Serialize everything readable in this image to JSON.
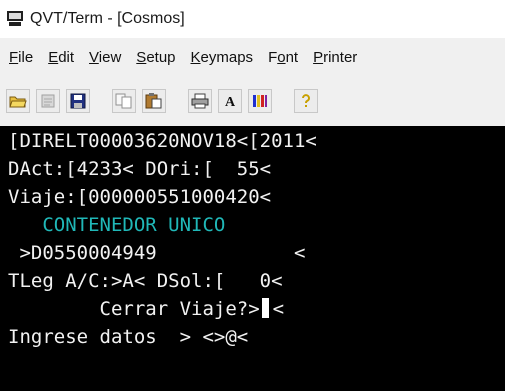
{
  "window": {
    "title": "QVT/Term - [Cosmos]"
  },
  "menu": {
    "file": "File",
    "edit": "Edit",
    "view": "View",
    "setup": "Setup",
    "keymaps": "Keymaps",
    "font": "Font",
    "printer": "Printer"
  },
  "toolbar": {
    "icons": [
      "open-folder-icon",
      "disabled-document-icon",
      "save-disk-icon",
      "copy-icon",
      "paste-icon",
      "print-icon",
      "font-a-icon",
      "color-bars-icon",
      "help-icon"
    ]
  },
  "terminal": {
    "line1": "[DIRELT00003620NOV18<[2011<",
    "line2": "DAct:[4233< DOri:[  55<",
    "line3": "Viaje:[000000551000420<",
    "line4": "   CONTENEDOR UNICO",
    "line5": " >D0550004949            <",
    "line6": "TLeg A/C:>A< DSol:[   0<",
    "line7_before_cursor": "        Cerrar Viaje?>",
    "line7_after_cursor": "<",
    "line8": "Ingrese datos  > <>@<",
    "colors": {
      "background": "#000000",
      "text": "#f2f2f2",
      "highlight": "#20b8b8"
    }
  }
}
